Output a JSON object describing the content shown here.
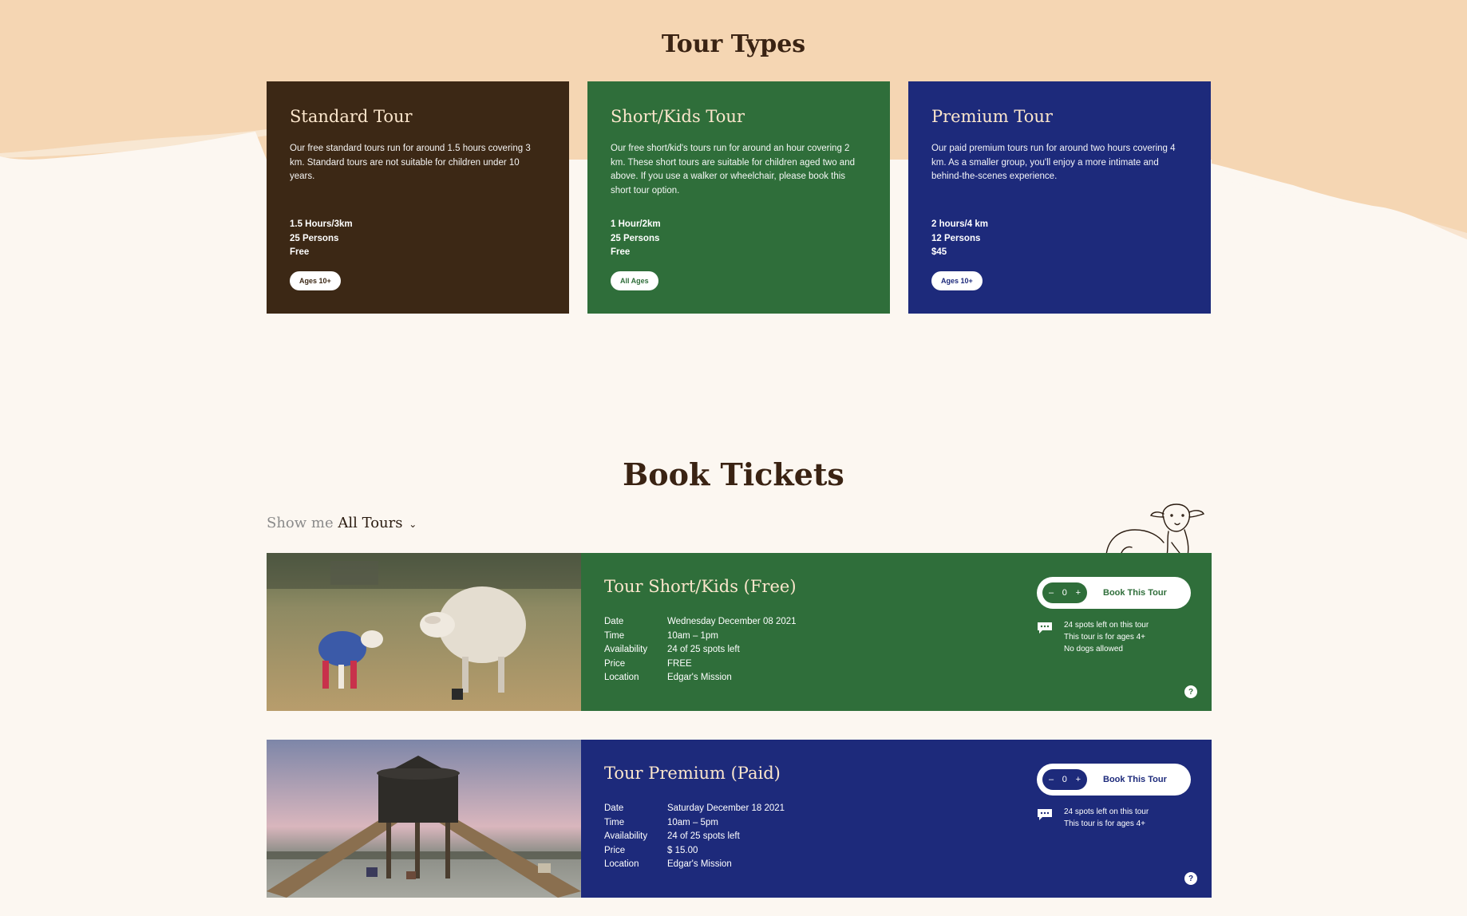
{
  "colors": {
    "background": "#fcf7f1",
    "top_band": "#f5d6b3",
    "standard": "#3c2815",
    "kids": "#2f6e3a",
    "premium": "#1d2a7b",
    "card_title": "#fbe6cc"
  },
  "tour_types": {
    "title": "Tour Types",
    "cards": [
      {
        "title": "Standard Tour",
        "description": "Our free standard tours run for around 1.5 hours covering 3 km. Standard tours are not suitable for children under 10 years.",
        "duration": "1.5 Hours/3km",
        "capacity": "25 Persons",
        "price": "Free",
        "age_badge": "Ages 10+"
      },
      {
        "title": "Short/Kids Tour",
        "description": "Our free short/kid's tours run for around an hour covering 2 km. These short tours are suitable for children aged two and above. If you use a walker or wheelchair, please book this short tour option.",
        "duration": "1 Hour/2km",
        "capacity": "25 Persons",
        "price": "Free",
        "age_badge": "All Ages"
      },
      {
        "title": "Premium Tour",
        "description": "Our paid premium tours run for around two hours covering 4 km. As a smaller group, you'll enjoy a more intimate and behind-the-scenes experience.",
        "duration": "2 hours/4 km",
        "capacity": "12 Persons",
        "price": "$45",
        "age_badge": "Ages 10+"
      }
    ]
  },
  "book_tickets": {
    "title": "Book Tickets",
    "filter": {
      "prefix": "Show me",
      "value": "All Tours",
      "chevron_icon": "chevron-down-icon"
    },
    "detail_labels": {
      "date": "Date",
      "time": "Time",
      "availability": "Availability",
      "price": "Price",
      "location": "Location"
    },
    "bookings": [
      {
        "title": "Tour Short/Kids (Free)",
        "date": "Wednesday December 08 2021",
        "time": "10am – 1pm",
        "availability": "24 of 25 spots left",
        "price": "FREE",
        "location": "Edgar's Mission",
        "quantity": "0",
        "minus": "–",
        "plus": "+",
        "book_label": "Book This Tour",
        "notes": [
          "24 spots left on this tour",
          "This tour is for ages 4+",
          "No dogs allowed"
        ],
        "help": "?"
      },
      {
        "title": "Tour Premium (Paid)",
        "date": "Saturday December 18 2021",
        "time": "10am – 5pm",
        "availability": "24 of 25 spots left",
        "price": "$ 15.00",
        "location": "Edgar's Mission",
        "quantity": "0",
        "minus": "–",
        "plus": "+",
        "book_label": "Book This Tour",
        "notes": [
          "24 spots left on this tour",
          "This tour is for ages 4+"
        ],
        "help": "?"
      }
    ]
  }
}
